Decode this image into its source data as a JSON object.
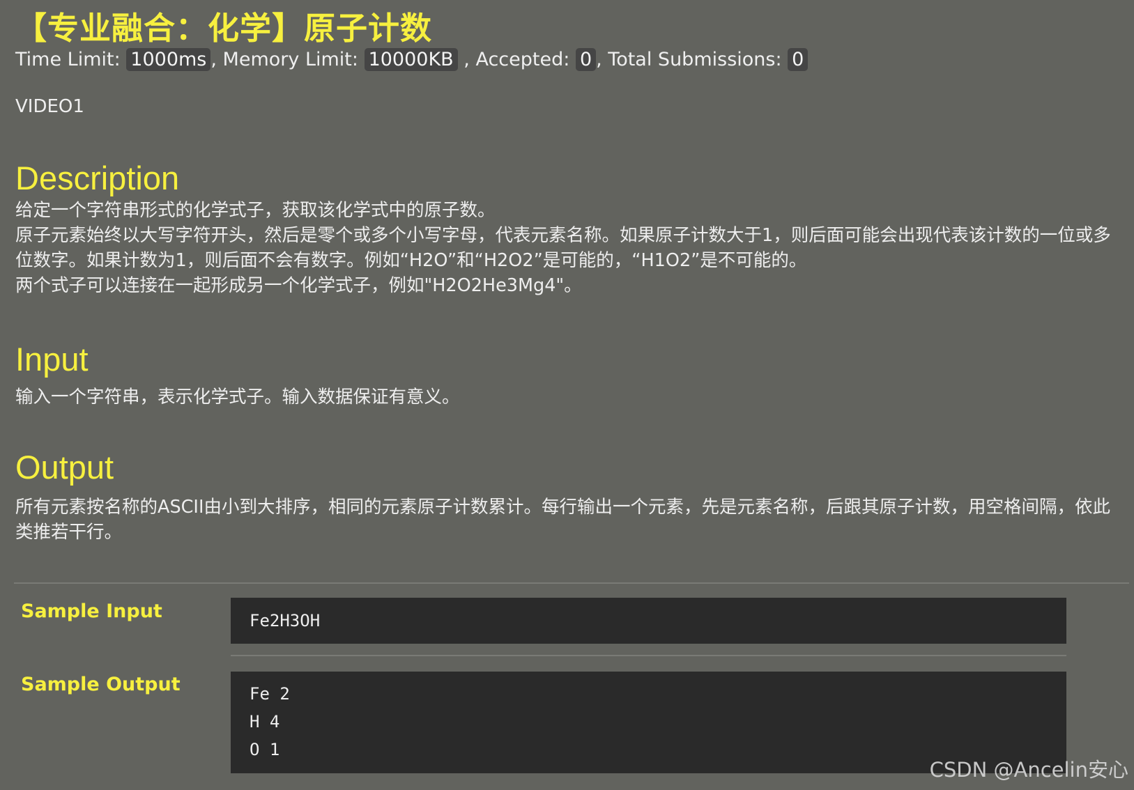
{
  "problem": {
    "title": "【专业融合：化学】原子计数",
    "limits": {
      "time_label": "Time Limit:",
      "time_value": "1000ms",
      "memory_label": ", Memory Limit:",
      "memory_value": "10000KB",
      "accepted_label": ", Accepted:",
      "accepted_value": "0",
      "total_label": ", Total Submissions:",
      "total_value": "0"
    },
    "video": "VIDEO1"
  },
  "description": {
    "heading": "Description",
    "lines": [
      "给定一个字符串形式的化学式子，获取该化学式中的原子数。",
      "原子元素始终以大写字符开头，然后是零个或多个小写字母，代表元素名称。如果原子计数大于1，则后面可能会出现代表该计数的一位或多位数字。如果计数为1，则后面不会有数字。例如“H2O”和“H2O2”是可能的，“H1O2”是不可能的。",
      "两个式子可以连接在一起形成另一个化学式子，例如\"H2O2He3Mg4\"。"
    ]
  },
  "input": {
    "heading": "Input",
    "text": "输入一个字符串，表示化学式子。输入数据保证有意义。"
  },
  "output": {
    "heading": "Output",
    "text": "所有元素按名称的ASCII由小到大排序，相同的元素原子计数累计。每行输出一个元素，先是元素名称，后跟其原子计数，用空格间隔，依此类推若干行。"
  },
  "sample_input": {
    "label": "Sample Input",
    "lines": [
      "Fe2H3OH"
    ]
  },
  "sample_output": {
    "label": "Sample Output",
    "lines": [
      "Fe 2",
      "H 4",
      "O 1"
    ]
  },
  "watermark": "CSDN @Ancelin安心",
  "colors": {
    "background": "#62635e",
    "heading_yellow": "#f7f03f",
    "code_background": "#2a2a2a"
  }
}
